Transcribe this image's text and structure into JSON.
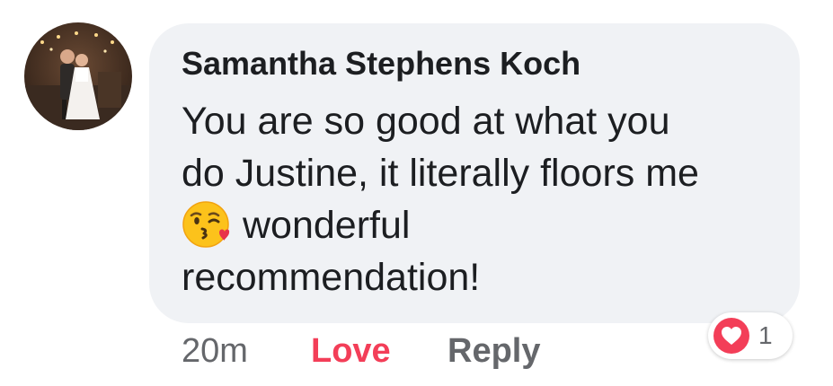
{
  "comment": {
    "author": "Samantha Stephens Koch",
    "text_lines": [
      "You are so good at what you",
      "do Justine, it literally floors me",
      "wonderful",
      "recommendation!"
    ],
    "emoji": "face-blowing-kiss-emoji",
    "timestamp": "20m",
    "love_label": "Love",
    "reply_label": "Reply",
    "reaction": {
      "icon": "heart-icon",
      "count": "1"
    }
  },
  "colors": {
    "bubble": "#f0f2f5",
    "text": "#1c1e21",
    "muted": "#65676b",
    "love": "#f33e58"
  }
}
